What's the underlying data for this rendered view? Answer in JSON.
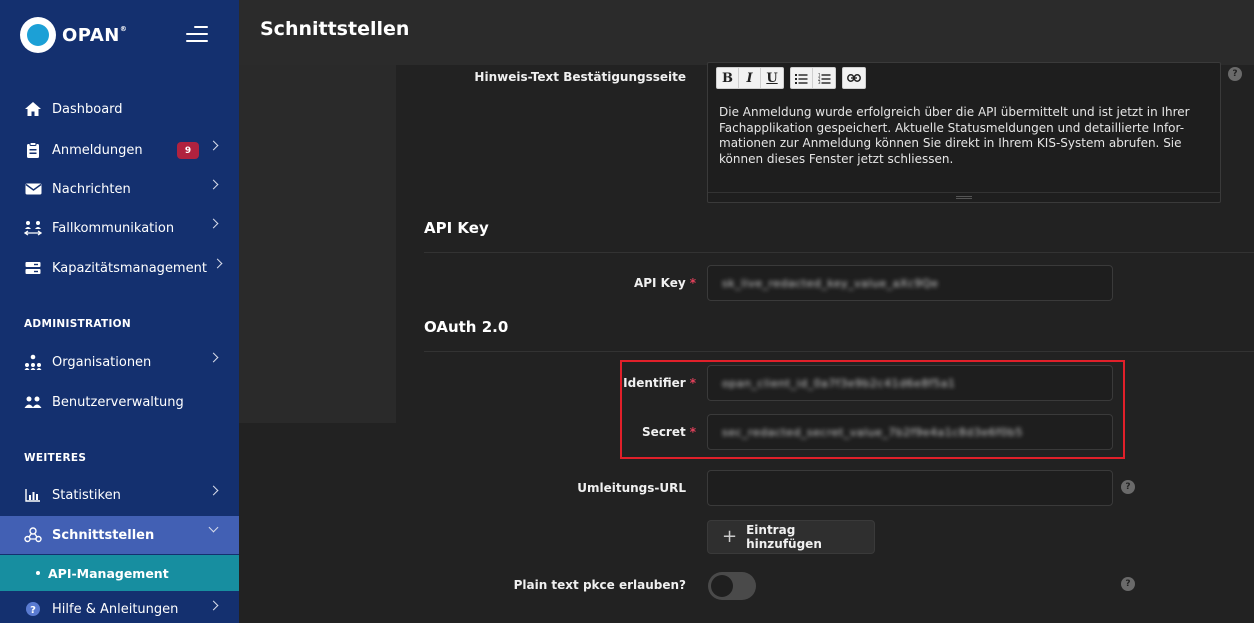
{
  "brand": {
    "name": "OPAN",
    "mark": "®"
  },
  "header": {
    "title": "Schnittstellen"
  },
  "sidebar": {
    "items": [
      {
        "label": "Dashboard"
      },
      {
        "label": "Anmeldungen",
        "badge": "9"
      },
      {
        "label": "Nachrichten"
      },
      {
        "label": "Fallkommunikation"
      },
      {
        "label": "Kapazitätsmanagement"
      }
    ],
    "admin_heading": "ADMINISTRATION",
    "admin_items": [
      {
        "label": "Organisationen"
      },
      {
        "label": "Benutzerverwaltung"
      }
    ],
    "more_heading": "WEITERES",
    "more_items": [
      {
        "label": "Statistiken"
      },
      {
        "label": "Schnittstellen"
      },
      {
        "label": "Hilfe & Anleitungen"
      }
    ],
    "sub_active": "API-Management"
  },
  "form": {
    "confirmation_label": "Hinweis-Text Bestätigungsseite",
    "confirmation_text": "Die Anmeldung wurde erfolgreich über die API übermittelt und ist jetzt in Ihrer Fachapplikation gespeichert. Aktuelle Statusmeldungen und detaillierte Infor-mationen zur Anmeldung können Sie direkt in Ihrem KIS-System abrufen. Sie können dieses Fenster jetzt schliessen.",
    "toolbar": {
      "bold": "B",
      "italic": "I",
      "underline": "U"
    },
    "api_section_title": "API Key",
    "api_key_label": "API Key",
    "api_key_value": "sk_live_redacted_key_value_aXc9Qe",
    "oauth_section_title": "OAuth 2.0",
    "identifier_label": "Identifier",
    "identifier_value": "opan_client_id_0a7f3e9b2c41d6e8f5a1",
    "secret_label": "Secret",
    "secret_value": "sec_redacted_secret_value_7b2f9e4a1c8d3e6f0b5",
    "redirect_label": "Umleitungs-URL",
    "redirect_value": "",
    "add_entry_label": "Eintrag hinzufügen",
    "pkce_label": "Plain text pkce erlauben?",
    "pkce_enabled": false,
    "required_mark": "*",
    "help_mark": "?"
  },
  "colors": {
    "sidebar_bg": "#14306f",
    "active_parent_bg": "#4260b4",
    "active_sub_bg": "#178ea0",
    "badge_bg": "#b0223f",
    "highlight_border": "#e0202a"
  }
}
